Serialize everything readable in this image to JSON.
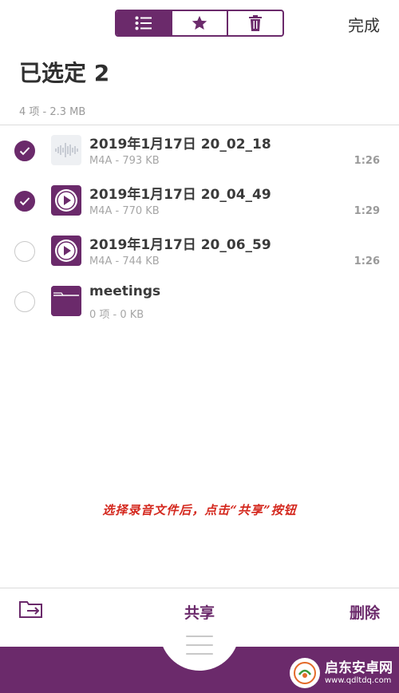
{
  "header": {
    "segments": [
      {
        "icon": "list-icon",
        "active": true
      },
      {
        "icon": "star-icon",
        "active": false
      },
      {
        "icon": "trash-icon",
        "active": false
      }
    ],
    "done_label": "完成"
  },
  "selection": {
    "title": "已选定 2",
    "summary": "4 项 - 2.3 MB"
  },
  "files": [
    {
      "name": "2019年1月17日 20_02_18",
      "meta": "M4A - 793 KB",
      "duration": "1:26",
      "selected": true,
      "thumb": "waveform-icon"
    },
    {
      "name": "2019年1月17日 20_04_49",
      "meta": "M4A - 770 KB",
      "duration": "1:29",
      "selected": true,
      "thumb": "play-icon"
    },
    {
      "name": "2019年1月17日 20_06_59",
      "meta": "M4A - 744 KB",
      "duration": "1:26",
      "selected": false,
      "thumb": "play-icon"
    },
    {
      "name": "meetings",
      "meta": "0 项 - 0 KB",
      "duration": "",
      "selected": false,
      "thumb": "folder-icon"
    }
  ],
  "caption": "选择录音文件后，点击“共享”按钮",
  "toolbar": {
    "move_icon": "move-to-folder-icon",
    "share_label": "共享",
    "delete_label": "删除"
  },
  "watermark": {
    "name": "启东安卓网",
    "url": "www.qdltdq.com"
  },
  "colors": {
    "accent": "#6b2a6b",
    "caption": "#d4281e"
  }
}
